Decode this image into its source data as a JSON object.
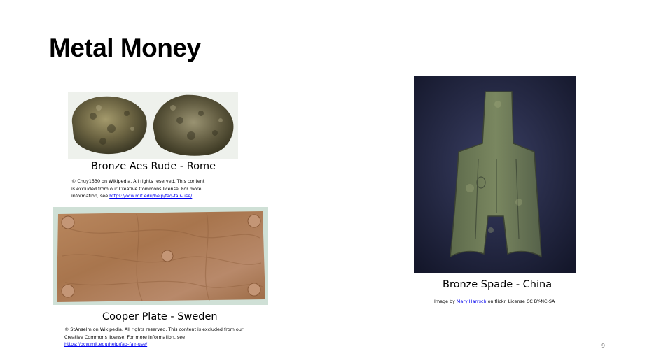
{
  "slide": {
    "title": "Metal Money",
    "page_number": "9"
  },
  "figures": {
    "aes_rude": {
      "caption": "Bronze Aes Rude - Rome",
      "credit_line1": "© Chuy1530 on Wikipedia. All rights reserved. This content",
      "credit_line2": "is excluded from our Creative Commons license. For more",
      "credit_line3_prefix": "information, see ",
      "credit_link": "https://ocw.mit.edu/help/faq-fair-use/"
    },
    "copper_plate": {
      "caption": "Cooper Plate - Sweden",
      "credit_line1": "© StAnselm on Wikipedia. All rights reserved. This content is excluded from our",
      "credit_line2": "Creative Commons license. For more information, see",
      "credit_link": "https://ocw.mit.edu/help/faq-fair-use/"
    },
    "spade": {
      "caption": "Bronze Spade - China",
      "credit_prefix": "Image by ",
      "credit_link": "Mary Harrsch",
      "credit_suffix": " on flickr. License CC BY-NC-SA"
    }
  }
}
